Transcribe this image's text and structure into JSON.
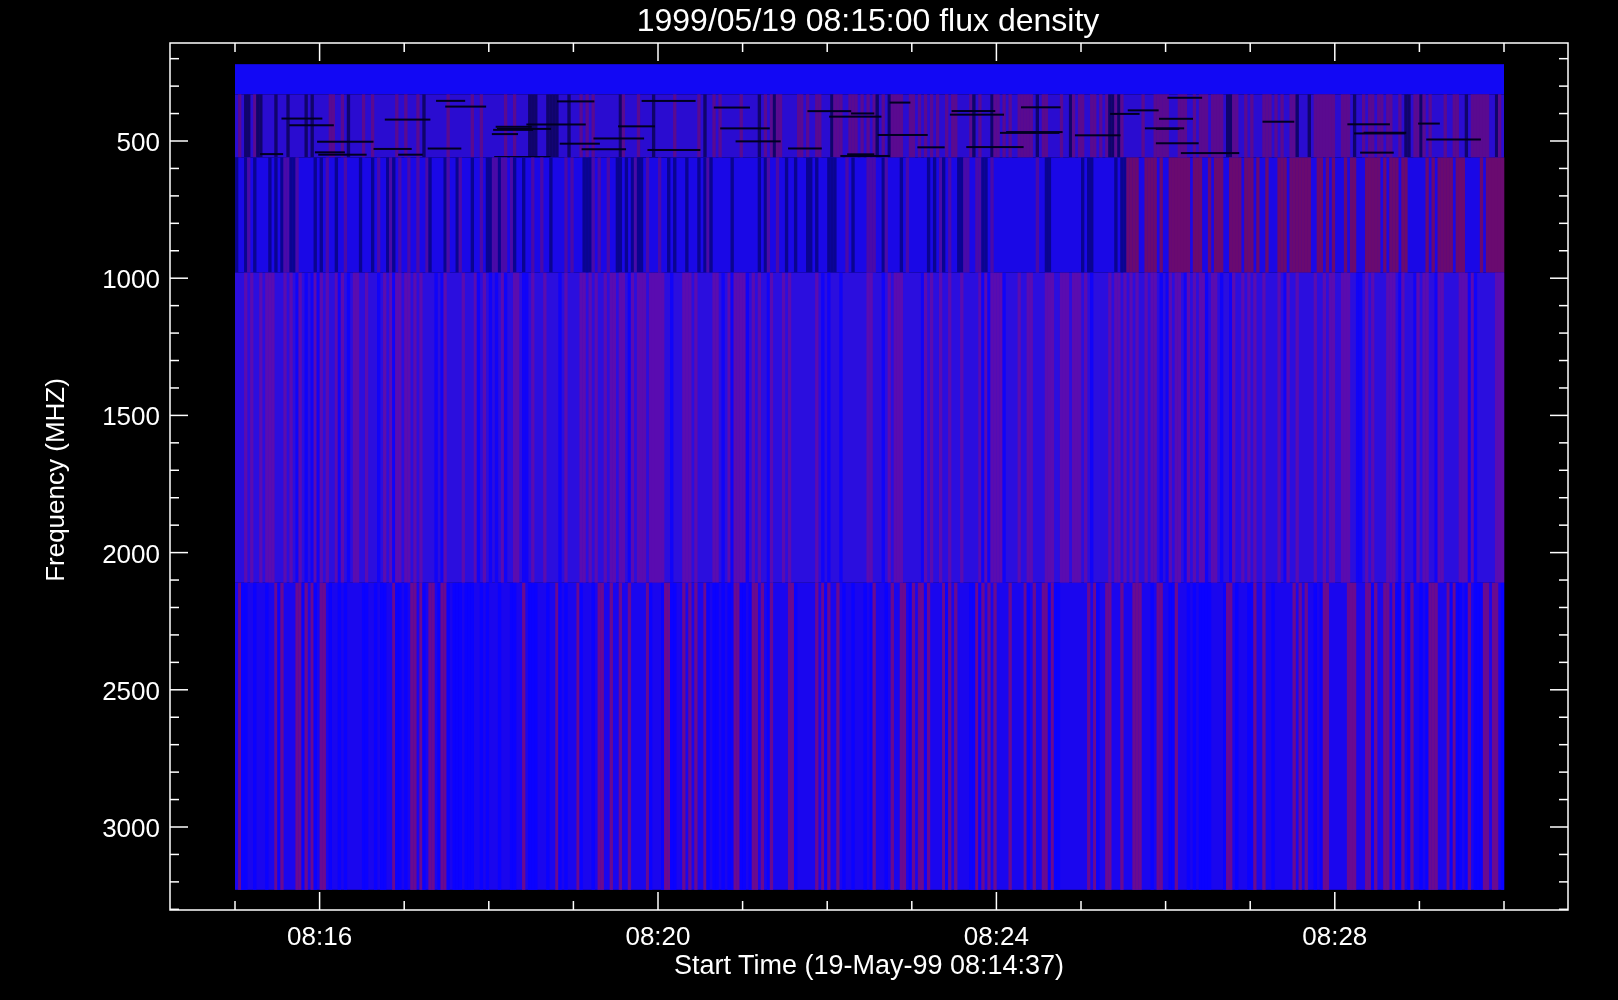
{
  "plot": {
    "title": "1999/05/19 08:15:00 flux density",
    "ylabel": "Frequency (MHZ)",
    "xlabel": "Start Time (19-May-99 08:14:37)",
    "yticks": [
      {
        "label": "500"
      },
      {
        "label": "1000"
      },
      {
        "label": "1500"
      },
      {
        "label": "2000"
      },
      {
        "label": "2500"
      },
      {
        "label": "3000"
      }
    ],
    "xticks": [
      {
        "label": "08:16"
      },
      {
        "label": "08:20"
      },
      {
        "label": "08:24"
      },
      {
        "label": "08:28"
      }
    ]
  }
}
